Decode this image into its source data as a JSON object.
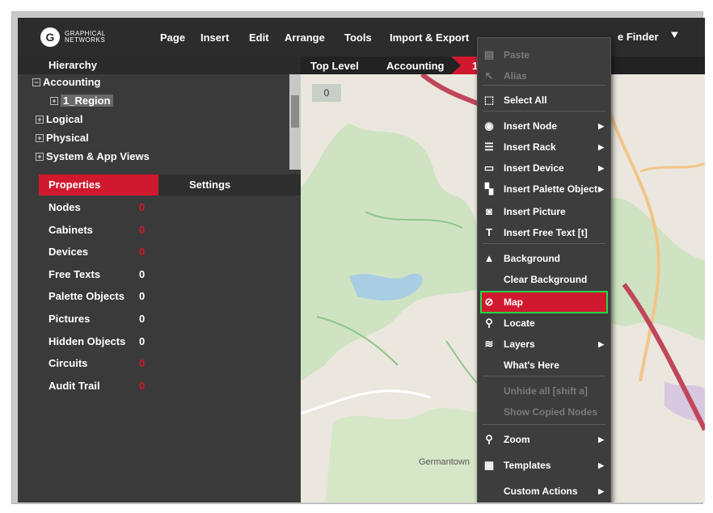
{
  "app": {
    "logo": {
      "line1": "GRAPHICAL",
      "line2": "NETWORKS",
      "mark": "G"
    },
    "menu": [
      "Page",
      "Insert",
      "Edit",
      "Arrange",
      "Tools",
      "Import & Export"
    ],
    "finder_label": "e Finder",
    "finder_icon": "collapse-icon"
  },
  "hierarchy": {
    "title": "Hierarchy",
    "items": [
      {
        "label": "Accounting",
        "expander": "−"
      },
      {
        "label": "1_Region",
        "expander": "+"
      },
      {
        "label": "Logical",
        "expander": "+"
      },
      {
        "label": "Physical",
        "expander": "+"
      },
      {
        "label": "System & App Views",
        "expander": "+"
      }
    ]
  },
  "tabs": {
    "properties": "Properties",
    "settings": "Settings"
  },
  "properties": [
    {
      "label": "Nodes",
      "value": "0",
      "value_color": "red"
    },
    {
      "label": "Cabinets",
      "value": "0",
      "value_color": "red"
    },
    {
      "label": "Devices",
      "value": "0",
      "value_color": "red"
    },
    {
      "label": "Free Texts",
      "value": "0",
      "value_color": "white"
    },
    {
      "label": "Palette Objects",
      "value": "0",
      "value_color": "white"
    },
    {
      "label": "Pictures",
      "value": "0",
      "value_color": "white"
    },
    {
      "label": "Hidden Objects",
      "value": "0",
      "value_color": "white"
    },
    {
      "label": "Circuits",
      "value": "0",
      "value_color": "red"
    },
    {
      "label": "Audit Trail",
      "value": "0",
      "value_color": "red"
    }
  ],
  "breadcrumbs": [
    "Top Level",
    "Accounting",
    "1"
  ],
  "canvas": {
    "zero_box": "0",
    "map_place_label": "Germantown"
  },
  "context_menu": [
    {
      "label": "Paste",
      "icon": "paste-icon",
      "glyph": "▤",
      "disabled": true,
      "submenu": false
    },
    {
      "label": "Alias",
      "icon": "alias-icon",
      "glyph": "↖",
      "disabled": true,
      "submenu": false
    },
    {
      "label": "Select All",
      "icon": "select-all-icon",
      "glyph": "⬚",
      "disabled": false,
      "submenu": false
    },
    {
      "label": "Insert Node",
      "icon": "node-icon",
      "glyph": "◉",
      "disabled": false,
      "submenu": true
    },
    {
      "label": "Insert Rack",
      "icon": "rack-icon",
      "glyph": "☰",
      "disabled": false,
      "submenu": true
    },
    {
      "label": "Insert Device",
      "icon": "device-icon",
      "glyph": "▭",
      "disabled": false,
      "submenu": true
    },
    {
      "label": "Insert Palette Object",
      "icon": "palette-object-icon",
      "glyph": "▚",
      "disabled": false,
      "submenu": true
    },
    {
      "label": "Insert Picture",
      "icon": "picture-icon",
      "glyph": "◙",
      "disabled": false,
      "submenu": false
    },
    {
      "label": "Insert Free Text [t]",
      "icon": "free-text-icon",
      "glyph": "T",
      "disabled": false,
      "submenu": false
    },
    {
      "label": "Background",
      "icon": "background-icon",
      "glyph": "▲",
      "disabled": false,
      "submenu": false
    },
    {
      "label": "Clear Background",
      "icon": "",
      "glyph": "",
      "disabled": false,
      "submenu": false
    },
    {
      "label": "Map",
      "icon": "map-off-icon",
      "glyph": "⊘",
      "disabled": false,
      "submenu": false,
      "active": true
    },
    {
      "label": "Locate",
      "icon": "locate-icon",
      "glyph": "⚲",
      "disabled": false,
      "submenu": false
    },
    {
      "label": "Layers",
      "icon": "layers-icon",
      "glyph": "≋",
      "disabled": false,
      "submenu": true
    },
    {
      "label": "What's Here",
      "icon": "",
      "glyph": "",
      "disabled": false,
      "submenu": false
    },
    {
      "label": "Unhide all [shift a]",
      "icon": "",
      "glyph": "",
      "disabled": true,
      "submenu": false
    },
    {
      "label": "Show Copied Nodes",
      "icon": "",
      "glyph": "",
      "disabled": true,
      "submenu": false
    },
    {
      "label": "Zoom",
      "icon": "zoom-icon",
      "glyph": "⚲",
      "disabled": false,
      "submenu": true
    },
    {
      "label": "Templates",
      "icon": "templates-icon",
      "glyph": "▦",
      "disabled": false,
      "submenu": true
    },
    {
      "label": "Custom Actions",
      "icon": "",
      "glyph": "",
      "disabled": false,
      "submenu": true
    }
  ],
  "colors": {
    "accent": "#d0192e",
    "highlight": "#26d64a",
    "panel": "#3a3a3a"
  }
}
